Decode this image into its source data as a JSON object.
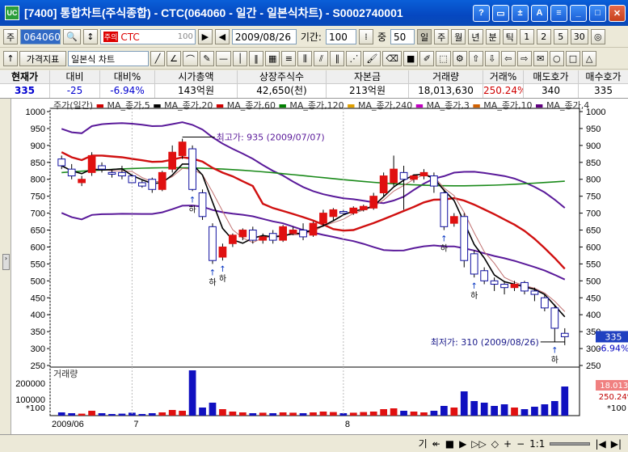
{
  "window": {
    "icon": "UC",
    "title": "[7400] 통합차트(주식종합) - CTC(064060 - 일간 - 일본식차트) - S0002740001",
    "controls": [
      "?",
      "▭",
      "±",
      "A",
      "≡",
      "_",
      "□",
      "✕"
    ]
  },
  "toolbar1": {
    "period_short": "주",
    "code": "064060",
    "badge": "주의",
    "stock_name": "CTC",
    "name_box_right": "100",
    "date": "2009/08/26",
    "period_label": "기간:",
    "period_value": "100",
    "overlap_label": "중",
    "overlap_value": "50",
    "intervals": [
      "일",
      "주",
      "월",
      "년",
      "분",
      "틱",
      "1",
      "2",
      "5",
      "30",
      "◎"
    ]
  },
  "toolbar2": {
    "indicator_button": "가격지표",
    "chart_type": "일본식 차트"
  },
  "quote": {
    "headers": [
      "현재가",
      "대비",
      "대비%",
      "시가총액",
      "상장주식수",
      "자본금",
      "거래량",
      "거래%",
      "매도호가",
      "매수호가"
    ],
    "values": [
      "335",
      "-25",
      "-6.94%",
      "143억원",
      "42,650(천)",
      "213억원",
      "18,013,630",
      "250.24%",
      "340",
      "335"
    ]
  },
  "chart": {
    "legend_prefix": "주가(일간)",
    "legend": [
      {
        "name": "MA_종가,5",
        "color": "#d00000"
      },
      {
        "name": "MA_종가,20",
        "color": "#000000"
      },
      {
        "name": "MA_종가,60",
        "color": "#d00000"
      },
      {
        "name": "MA_종가,120",
        "color": "#008000"
      },
      {
        "name": "MA_종가,240",
        "color": "#e0a000"
      },
      {
        "name": "MA_종가,3",
        "color": "#c000c0"
      },
      {
        "name": "MA_종가,10",
        "color": "#d06000"
      },
      {
        "name": "MA_종가,4",
        "color": "#600080"
      }
    ],
    "high_label": "최고가: 935 (2009/07/07)",
    "low_label": "최저가: 310 (2009/08/26)",
    "signal_label": "하",
    "price_tag": "335",
    "pct_tag": "-6.94%",
    "volume_title": "거래량",
    "volume_tag": "18.013K",
    "volume_pct_tag": "250.24%",
    "multiplier": "*100",
    "date_labels": [
      "2009/06",
      "7",
      "8"
    ]
  },
  "status": {
    "items": [
      "기",
      "↞",
      "■",
      "▶",
      "▷▷",
      "◇",
      "+",
      "−",
      "1:1"
    ]
  },
  "chart_data": {
    "type": "candlestick",
    "x_label": "",
    "y_axis": {
      "min": 250,
      "max": 1000,
      "ticks": [
        250,
        300,
        350,
        400,
        450,
        500,
        550,
        600,
        650,
        700,
        750,
        800,
        850,
        900,
        950,
        1000
      ]
    },
    "volume_axis": {
      "min": 0,
      "max": 300000,
      "ticks": [
        100000,
        200000
      ]
    },
    "candles": [
      {
        "o": 860,
        "c": 840,
        "h": 870,
        "l": 830
      },
      {
        "o": 830,
        "c": 810,
        "h": 845,
        "l": 800
      },
      {
        "o": 790,
        "c": 800,
        "h": 810,
        "l": 780
      },
      {
        "o": 820,
        "c": 870,
        "h": 880,
        "l": 810
      },
      {
        "o": 840,
        "c": 830,
        "h": 850,
        "l": 820
      },
      {
        "o": 820,
        "c": 815,
        "h": 830,
        "l": 805
      },
      {
        "o": 820,
        "c": 810,
        "h": 840,
        "l": 800
      },
      {
        "o": 810,
        "c": 790,
        "h": 815,
        "l": 785
      },
      {
        "o": 790,
        "c": 780,
        "h": 800,
        "l": 775
      },
      {
        "o": 800,
        "c": 770,
        "h": 805,
        "l": 760
      },
      {
        "o": 770,
        "c": 820,
        "h": 825,
        "l": 765
      },
      {
        "o": 830,
        "c": 880,
        "h": 900,
        "l": 820
      },
      {
        "o": 870,
        "c": 910,
        "h": 920,
        "l": 860
      },
      {
        "o": 890,
        "c": 770,
        "h": 900,
        "l": 765
      },
      {
        "o": 760,
        "c": 690,
        "h": 770,
        "l": 680
      },
      {
        "o": 660,
        "c": 560,
        "h": 670,
        "l": 550
      },
      {
        "o": 570,
        "c": 600,
        "h": 610,
        "l": 560
      },
      {
        "o": 610,
        "c": 635,
        "h": 640,
        "l": 600
      },
      {
        "o": 630,
        "c": 650,
        "h": 655,
        "l": 620
      },
      {
        "o": 650,
        "c": 620,
        "h": 660,
        "l": 610
      },
      {
        "o": 620,
        "c": 630,
        "h": 640,
        "l": 610
      },
      {
        "o": 640,
        "c": 620,
        "h": 650,
        "l": 610
      },
      {
        "o": 620,
        "c": 660,
        "h": 665,
        "l": 615
      },
      {
        "o": 640,
        "c": 650,
        "h": 660,
        "l": 635
      },
      {
        "o": 650,
        "c": 630,
        "h": 670,
        "l": 620
      },
      {
        "o": 635,
        "c": 670,
        "h": 675,
        "l": 630
      },
      {
        "o": 670,
        "c": 700,
        "h": 710,
        "l": 660
      },
      {
        "o": 690,
        "c": 710,
        "h": 715,
        "l": 680
      },
      {
        "o": 705,
        "c": 700,
        "h": 710,
        "l": 695
      },
      {
        "o": 700,
        "c": 715,
        "h": 720,
        "l": 695
      },
      {
        "o": 710,
        "c": 720,
        "h": 725,
        "l": 705
      },
      {
        "o": 715,
        "c": 750,
        "h": 760,
        "l": 710
      },
      {
        "o": 760,
        "c": 810,
        "h": 820,
        "l": 750
      },
      {
        "o": 790,
        "c": 830,
        "h": 870,
        "l": 780
      },
      {
        "o": 820,
        "c": 800,
        "h": 840,
        "l": 710
      },
      {
        "o": 800,
        "c": 810,
        "h": 815,
        "l": 790
      },
      {
        "o": 810,
        "c": 820,
        "h": 830,
        "l": 800
      },
      {
        "o": 810,
        "c": 780,
        "h": 820,
        "l": 760
      },
      {
        "o": 760,
        "c": 660,
        "h": 770,
        "l": 650
      },
      {
        "o": 670,
        "c": 690,
        "h": 700,
        "l": 660
      },
      {
        "o": 690,
        "c": 560,
        "h": 700,
        "l": 540
      },
      {
        "o": 580,
        "c": 520,
        "h": 590,
        "l": 510
      },
      {
        "o": 530,
        "c": 500,
        "h": 540,
        "l": 490
      },
      {
        "o": 500,
        "c": 490,
        "h": 510,
        "l": 470
      },
      {
        "o": 490,
        "c": 480,
        "h": 500,
        "l": 460
      },
      {
        "o": 480,
        "c": 490,
        "h": 500,
        "l": 470
      },
      {
        "o": 495,
        "c": 470,
        "h": 500,
        "l": 460
      },
      {
        "o": 470,
        "c": 460,
        "h": 480,
        "l": 440
      },
      {
        "o": 450,
        "c": 420,
        "h": 460,
        "l": 410
      },
      {
        "o": 420,
        "c": 360,
        "h": 430,
        "l": 320
      },
      {
        "o": 345,
        "c": 335,
        "h": 360,
        "l": 310
      }
    ],
    "volume": [
      20000,
      15000,
      12000,
      30000,
      15000,
      10000,
      12000,
      18000,
      10000,
      15000,
      20000,
      35000,
      30000,
      280000,
      50000,
      80000,
      40000,
      25000,
      20000,
      15000,
      18000,
      15000,
      20000,
      18000,
      15000,
      20000,
      25000,
      22000,
      15000,
      18000,
      22000,
      25000,
      40000,
      45000,
      30000,
      25000,
      20000,
      30000,
      60000,
      50000,
      150000,
      90000,
      80000,
      60000,
      70000,
      50000,
      40000,
      55000,
      70000,
      90000,
      180000
    ]
  }
}
